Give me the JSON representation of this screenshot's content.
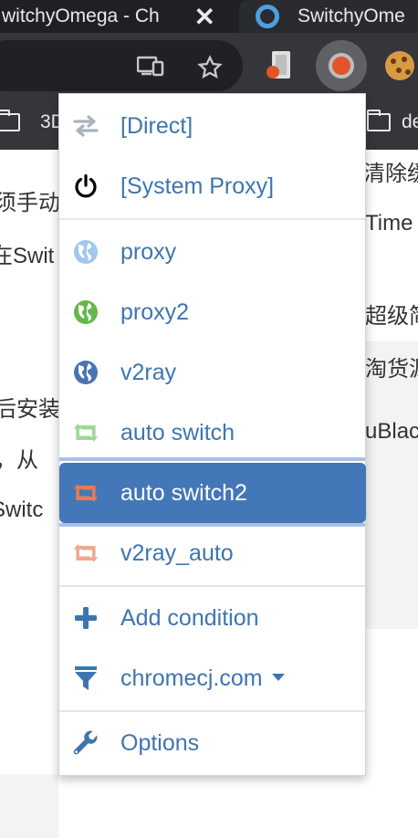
{
  "tabs": [
    {
      "title": "witchyOmega - Ch",
      "close": "✕"
    },
    {
      "title": "SwitchyOme"
    }
  ],
  "toolbar": {
    "cast_icon": "cast-icon",
    "star_icon": "star-icon"
  },
  "bookmarks": [
    {
      "label": "3D"
    },
    {
      "label": "de"
    }
  ],
  "page": {
    "texts": [
      "清除缓",
      "须手动",
      "Time",
      "在Swit",
      "超级简",
      "淘货源",
      "后安装",
      "uBlac",
      "，从",
      "Switc"
    ]
  },
  "menu": {
    "items": [
      {
        "label": "[Direct]",
        "icon": "direct-arrows-icon",
        "color": "#aab2bd"
      },
      {
        "label": "[System Proxy]",
        "icon": "power-icon",
        "color": "#000000"
      },
      {
        "label": "proxy",
        "icon": "globe-icon",
        "color": "#a2c6ec"
      },
      {
        "label": "proxy2",
        "icon": "globe-icon",
        "color": "#66b74c"
      },
      {
        "label": "v2ray",
        "icon": "globe-icon",
        "color": "#4a74b0"
      },
      {
        "label": "auto switch",
        "icon": "retweet-icon",
        "color": "#9fd79a"
      },
      {
        "label": "auto switch2",
        "icon": "retweet-icon",
        "color": "#e57c52",
        "selected": true
      },
      {
        "label": "v2ray_auto",
        "icon": "retweet-icon",
        "color": "#f0a88c"
      },
      {
        "label": "Add condition",
        "icon": "plus-icon",
        "color": "#3e75b0"
      },
      {
        "label": "chromecj.com",
        "icon": "filter-icon",
        "color": "#3e75b0"
      },
      {
        "label": "Options",
        "icon": "wrench-icon",
        "color": "#3e75b0"
      }
    ]
  }
}
